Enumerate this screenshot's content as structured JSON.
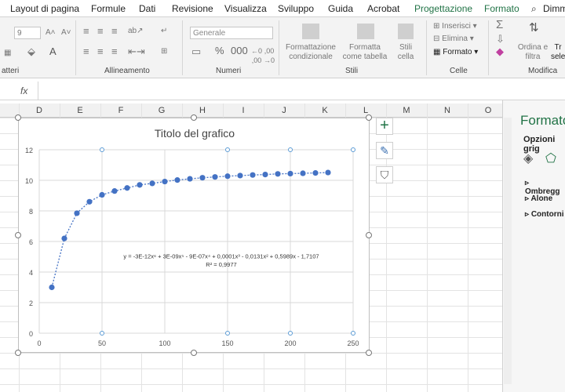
{
  "ribbon_tabs": [
    {
      "label": "Layout di pagina",
      "ctx": false
    },
    {
      "label": "Formule",
      "ctx": false
    },
    {
      "label": "Dati",
      "ctx": false
    },
    {
      "label": "Revisione",
      "ctx": false
    },
    {
      "label": "Visualizza",
      "ctx": false
    },
    {
      "label": "Sviluppo",
      "ctx": false
    },
    {
      "label": "Guida",
      "ctx": false
    },
    {
      "label": "Acrobat",
      "ctx": false
    },
    {
      "label": "Progettazione",
      "ctx": true
    },
    {
      "label": "Formato",
      "ctx": true
    }
  ],
  "tell_me": "Dimm",
  "font_size": "9",
  "number_format": "Generale",
  "groups": {
    "font": "atteri",
    "alignment": "Allineamento",
    "numbers": "Numeri",
    "styles": "Stili",
    "cells": "Celle",
    "editing": "Modifica"
  },
  "styles_buttons": {
    "cond": "Formattazione condizionale",
    "table": "Formatta come tabella",
    "cell": "Stili cella"
  },
  "cells_buttons": {
    "insert": "Inserisci",
    "delete": "Elimina",
    "format": "Formato"
  },
  "editing_buttons": {
    "sort": "Ordina e filtra",
    "find": "Tr sele"
  },
  "fx": "fx",
  "columns": [
    "D",
    "E",
    "F",
    "G",
    "H",
    "I",
    "J",
    "K",
    "L",
    "M",
    "N",
    "O"
  ],
  "chart_data": {
    "type": "scatter",
    "title": "Titolo del grafico",
    "xlim": [
      0,
      250
    ],
    "ylim": [
      0,
      12
    ],
    "xticks": [
      0,
      50,
      100,
      150,
      200,
      250
    ],
    "yticks": [
      0,
      2,
      4,
      6,
      8,
      10,
      12
    ],
    "points": [
      [
        10,
        3
      ],
      [
        20,
        6.2
      ],
      [
        30,
        7.85
      ],
      [
        40,
        8.6
      ],
      [
        50,
        9.05
      ],
      [
        60,
        9.3
      ],
      [
        70,
        9.5
      ],
      [
        80,
        9.7
      ],
      [
        90,
        9.8
      ],
      [
        100,
        9.92
      ],
      [
        110,
        10.02
      ],
      [
        120,
        10.1
      ],
      [
        130,
        10.17
      ],
      [
        140,
        10.22
      ],
      [
        150,
        10.27
      ],
      [
        160,
        10.31
      ],
      [
        170,
        10.35
      ],
      [
        180,
        10.38
      ],
      [
        190,
        10.42
      ],
      [
        200,
        10.44
      ],
      [
        210,
        10.46
      ],
      [
        220,
        10.48
      ],
      [
        230,
        10.51
      ]
    ],
    "trendline_equation": "y = -3E-12x⁶ + 3E-09x⁵ - 9E-07x⁴ + 0,0001x³ - 0,0131x² + 0,5989x - 1,7107",
    "r_squared": "R² = 0,9977",
    "grid": true,
    "marker_color": "#4472c4"
  },
  "pane": {
    "title": "Formato",
    "subtitle": "Opzioni grig",
    "items": [
      "Ombregg",
      "Alone",
      "Contorni"
    ]
  }
}
